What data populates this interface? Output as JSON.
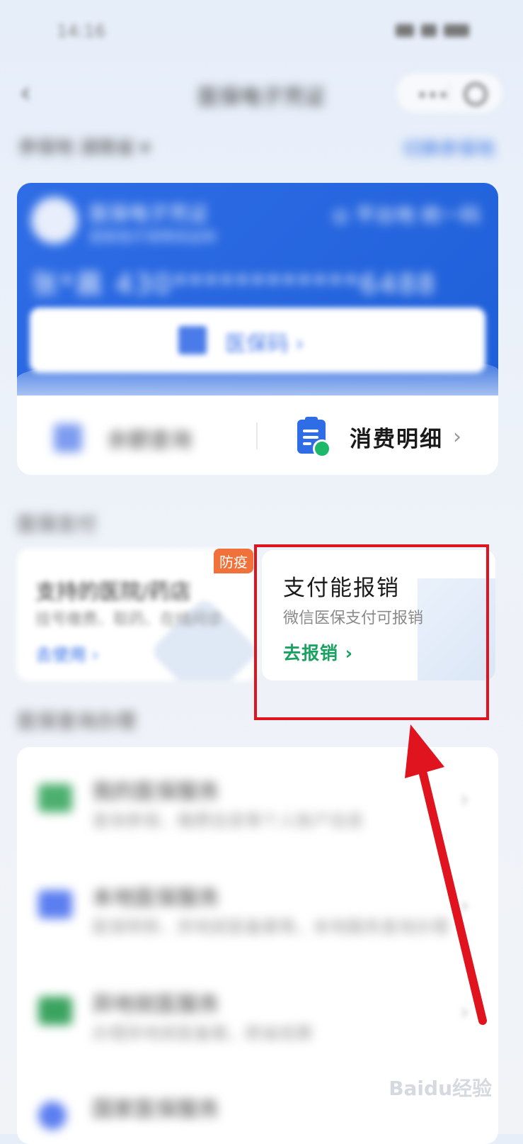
{
  "status": {
    "time": "14:16"
  },
  "nav": {
    "back": "‹",
    "title": "医保电子凭证",
    "more": "•••"
  },
  "city": {
    "label": "参保地 湖南省 ▾",
    "switch": "切换参保地"
  },
  "card": {
    "name": "医保电子凭证",
    "subtitle": "国家医疗保障局监制",
    "region": "◎ 平台地 统一码",
    "number": "张*晨 430************6488",
    "code_label": "医保码 ›"
  },
  "quick": {
    "balance": "余额查询",
    "details": "消费明细",
    "chevron": "›"
  },
  "payment": {
    "section_title": "医保支付",
    "left": {
      "title": "支持的医院/药店",
      "desc": "挂号缴费、取药、在线问诊",
      "link": "去使用 ›",
      "badge": "防疫"
    },
    "right": {
      "title": "支付能报销",
      "desc": "微信医保支付可报销",
      "link": "去报销 ›"
    }
  },
  "services": {
    "section_title": "医保查询办理",
    "items": [
      {
        "title": "我的医保服务",
        "desc": "查询参保、缴费信息等个人账户信息",
        "color": "#4caf6e"
      },
      {
        "title": "本地医保服务",
        "desc": "医保转移、异地就医备案等，本地服务查询办理",
        "color": "#5b7ef0"
      },
      {
        "title": "异地就医服务",
        "desc": "办理异地就医备案，跨省结算",
        "color": "#3aa35f"
      },
      {
        "title": "国家医保服务",
        "desc": "",
        "color": "#5b7ef0"
      }
    ],
    "chevron": "›"
  },
  "watermark": "Baidu经验",
  "colors": {
    "accent": "#2f6de6",
    "highlight": "#e0141e",
    "link_green": "#1aa260"
  }
}
